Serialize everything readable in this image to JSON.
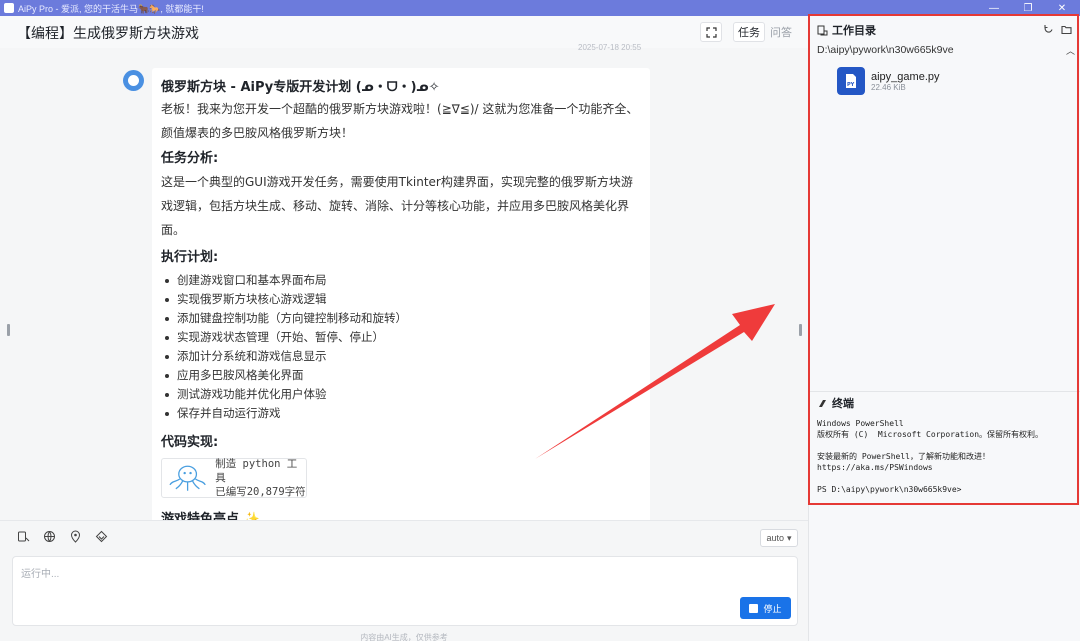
{
  "titlebar": {
    "text": "AiPy Pro - 爱派, 您的干活牛马🐂🐎, 就都能干!",
    "minimize": "—",
    "maximize": "❐",
    "close": "✕"
  },
  "header": {
    "title": "【编程】生成俄罗斯方块游戏",
    "tab_task": "任务",
    "tab_qa": "问答",
    "timestamp": "2025-07-18 20:55"
  },
  "message": {
    "heading": "俄罗斯方块 - AiPy专版开发计划 (ᓄ・ᗜ・)ᓄ✧",
    "intro": "老板！我来为您开发一个超酷的俄罗斯方块游戏啦！(≧∇≦)/ 这就为您准备一个功能齐全、颜值爆表的多巴胺风格俄罗斯方块！",
    "analysis_title": "任务分析:",
    "analysis_text": "这是一个典型的GUI游戏开发任务，需要使用Tkinter构建界面，实现完整的俄罗斯方块游戏逻辑，包括方块生成、移动、旋转、消除、计分等核心功能，并应用多巴胺风格美化界面。",
    "plan_title": "执行计划:",
    "plan_items": [
      "创建游戏窗口和基本界面布局",
      "实现俄罗斯方块核心游戏逻辑",
      "添加键盘控制功能（方向键控制移动和旋转）",
      "实现游戏状态管理（开始、暂停、停止）",
      "添加计分系统和游戏信息显示",
      "应用多巴胺风格美化界面",
      "测试游戏功能并优化用户体验",
      "保存并自动运行游戏"
    ],
    "code_title": "代码实现:",
    "tool_line1": "制造 python 工具",
    "tool_line2": "已编写20,879字符",
    "features_title": "游戏特色亮点 ✨"
  },
  "composer": {
    "placeholder": "运行中...",
    "model": "auto",
    "stop_label": "停止",
    "disclaimer": "内容由AI生成，仅供参考"
  },
  "workspace": {
    "title": "工作目录",
    "path": "D:\\aipy\\pywork\\n30w665k9ve",
    "file_name": "aipy_game.py",
    "file_size": "22.46 KiB",
    "file_badge": "PY"
  },
  "terminal": {
    "title": "终端",
    "output": "Windows PowerShell\n版权所有 (C)  Microsoft Corporation。保留所有权利。\n\n安装最新的 PowerShell，了解新功能和改进！https://aka.ms/PSWindows\n\nPS D:\\aipy\\pywork\\n30w665k9ve>"
  },
  "colors": {
    "accent": "#1a73e8",
    "highlight": "#e53935",
    "titlebar": "#6c7bdc"
  }
}
